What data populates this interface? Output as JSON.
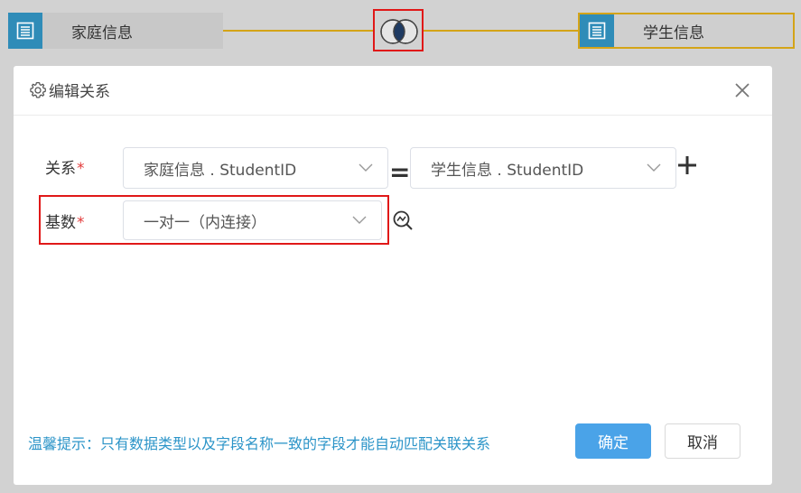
{
  "canvas": {
    "left_table": {
      "label": "家庭信息",
      "icon": "table-icon"
    },
    "right_table": {
      "label": "学生信息",
      "icon": "table-icon"
    },
    "join_icon": "inner-join-venn-icon",
    "line_color": "#d4a418",
    "highlight_color": "#e01818"
  },
  "dialog": {
    "title": "编辑关系",
    "title_icon": "gear-icon",
    "close_icon": "close-icon",
    "relation": {
      "label": "关系",
      "required_mark": "*",
      "left_field": "家庭信息 . StudentID",
      "operator": "=",
      "right_field": "学生信息 . StudentID",
      "add_icon": "plus-icon"
    },
    "cardinality": {
      "label": "基数",
      "required_mark": "*",
      "value": "一对一（内连接）",
      "preview_icon": "chart-zoom-icon"
    },
    "hint": "温馨提示：只有数据类型以及字段名称一致的字段才能自动匹配关联关系",
    "ok_label": "确定",
    "cancel_label": "取消",
    "accent_color": "#4aa3e8",
    "hint_color": "#2b94c8"
  }
}
